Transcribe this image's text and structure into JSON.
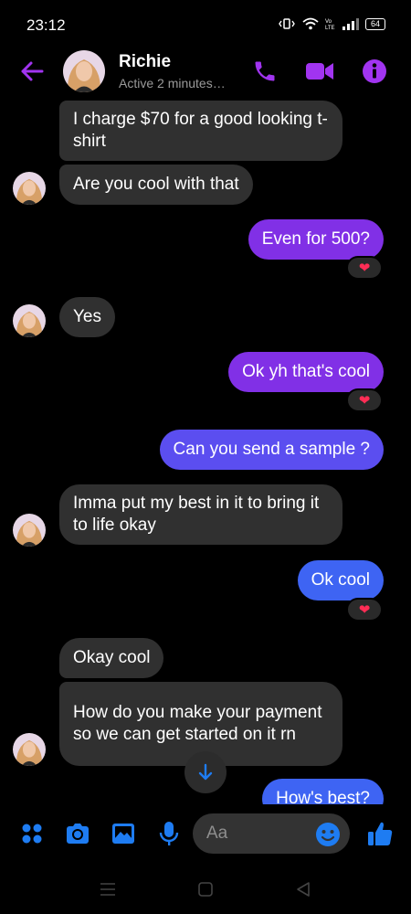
{
  "status_bar": {
    "time": "23:12",
    "battery": "64",
    "icons": [
      "vibrate-icon",
      "wifi-icon",
      "volte-icon",
      "signal-icon",
      "battery-icon"
    ]
  },
  "header": {
    "name": "Richie",
    "status": "Active 2 minutes…",
    "icons": [
      "back-arrow-icon",
      "phone-icon",
      "video-call-icon",
      "info-icon"
    ],
    "accent": "#a134f0"
  },
  "messages": [
    {
      "from": "them",
      "text": "I charge $70 for a good looking t-shirt"
    },
    {
      "from": "them",
      "text": "Are you cool with that"
    },
    {
      "from": "me",
      "text": "Even for 500?",
      "reaction": "❤"
    },
    {
      "from": "them",
      "text": "Yes"
    },
    {
      "from": "me",
      "text": "Ok yh that's cool",
      "reaction": "❤"
    },
    {
      "from": "me",
      "text": "Can you send a sample ?"
    },
    {
      "from": "them",
      "text": "Imma put my best in it to bring it to life okay"
    },
    {
      "from": "me",
      "text": "Ok cool",
      "reaction": "❤"
    },
    {
      "from": "them",
      "text": "Okay cool"
    },
    {
      "from": "them",
      "text": "How do you make your payment so we can get started on it rn"
    },
    {
      "from": "me",
      "text": "How's best?"
    }
  ],
  "bubble_colors": {
    "received": "#303030",
    "sent_purple": "#8130e6",
    "sent_violet": "#5b4ef0",
    "sent_blue": "#3e64f3"
  },
  "composer": {
    "placeholder": "Aa",
    "icons": [
      "apps-icon",
      "camera-icon",
      "gallery-icon",
      "microphone-icon",
      "emoji-icon",
      "thumbs-up-icon"
    ],
    "accent": "#1e7cf2"
  },
  "nav_bar": {
    "icons": [
      "recent-apps-icon",
      "home-icon",
      "back-icon"
    ]
  }
}
